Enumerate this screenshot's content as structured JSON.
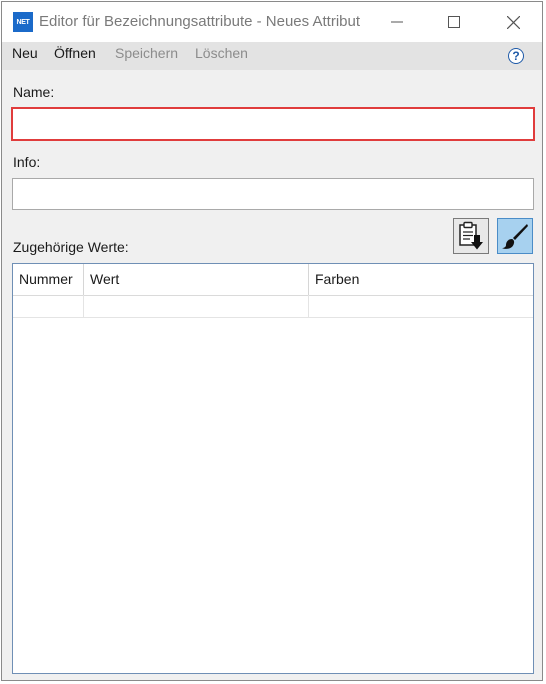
{
  "window": {
    "app_icon_text": "NET",
    "title": "Editor für Bezeichnungsattribute - Neues Attribut"
  },
  "menu": {
    "items": [
      {
        "label": "Neu",
        "enabled": true
      },
      {
        "label": "Öffnen",
        "enabled": true
      },
      {
        "label": "Speichern",
        "enabled": false
      },
      {
        "label": "Löschen",
        "enabled": false
      }
    ],
    "help_label": "?"
  },
  "form": {
    "name_label": "Name:",
    "name_value": "",
    "info_label": "Info:",
    "info_value": "",
    "values_label": "Zugehörige Werte:"
  },
  "toolbar": {
    "paste_icon": "paste-clipboard-icon",
    "brush_icon": "paint-brush-icon"
  },
  "grid": {
    "columns": [
      "Nummer",
      "Wert",
      "Farben"
    ],
    "rows": [
      [
        "",
        "",
        ""
      ]
    ]
  },
  "colors": {
    "error_border": "#e03c3c",
    "active_button": "#a7d1ef",
    "app_icon": "#1b6ac9"
  }
}
